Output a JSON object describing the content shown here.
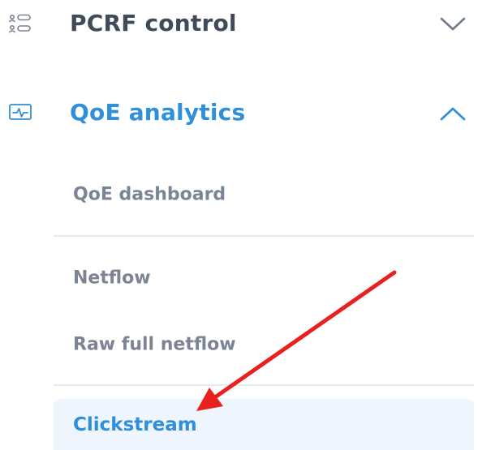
{
  "menu": {
    "groups": [
      {
        "label": "PCRF control",
        "icon": "pcrf-control-icon",
        "expanded": false,
        "chevron": "chevron-down-icon"
      },
      {
        "label": "QoE analytics",
        "icon": "analytics-monitor-icon",
        "expanded": true,
        "chevron": "chevron-up-icon",
        "items": [
          {
            "label": "QoE dashboard"
          },
          {
            "label": "Netflow"
          },
          {
            "label": "Raw full netflow"
          },
          {
            "label": "Clickstream",
            "active": true
          }
        ]
      }
    ]
  },
  "annotation": {
    "type": "arrow",
    "color": "#e8201e",
    "points_to": "Clickstream"
  },
  "colors": {
    "active": "#2f8fd8",
    "text_dark": "#3f4a5a",
    "text_muted": "#7a8494",
    "active_bg": "#eef5fc",
    "divider": "#e6e9ee"
  }
}
